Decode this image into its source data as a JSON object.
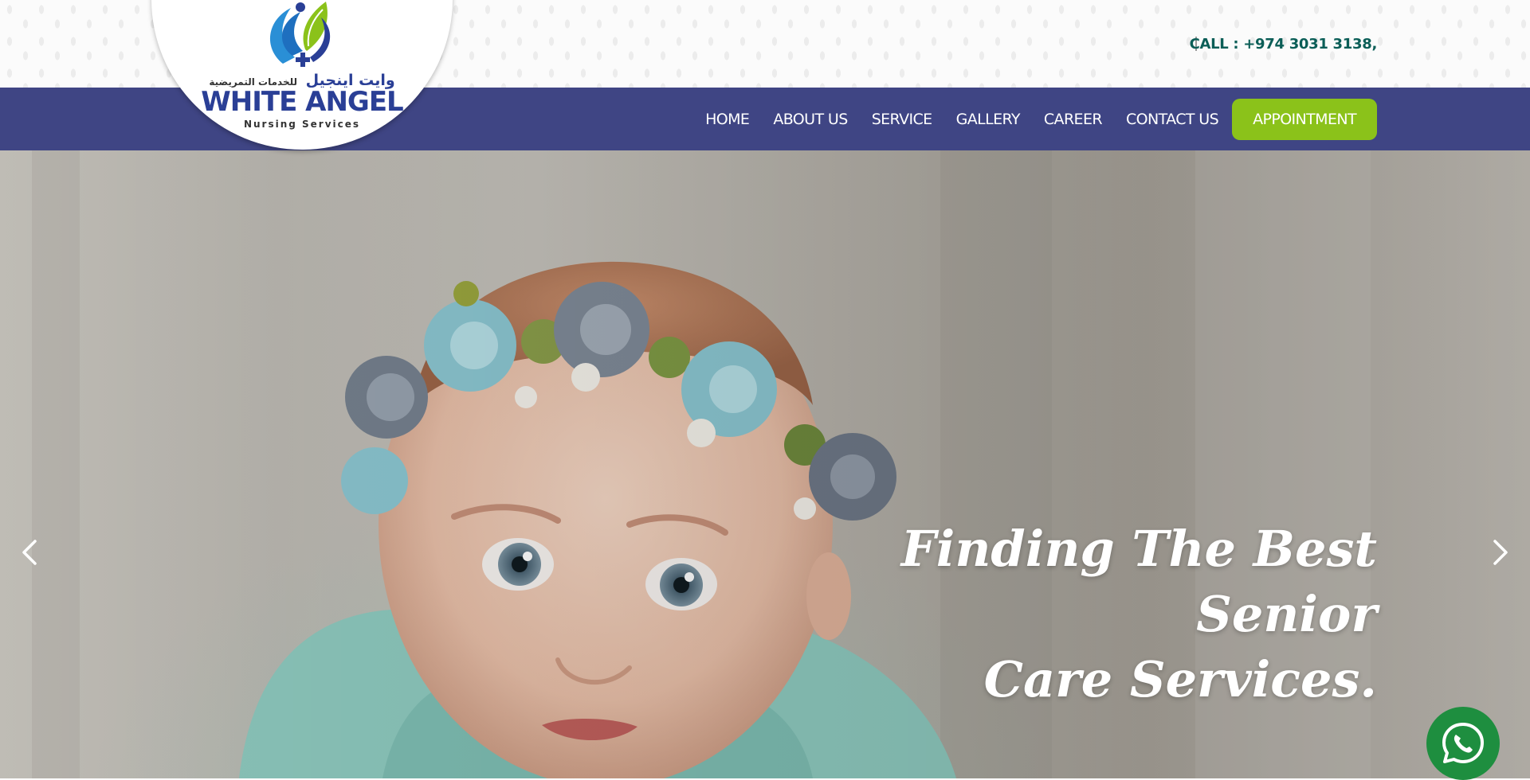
{
  "header": {
    "call_text": "CALL : +974 3031 3138,"
  },
  "logo": {
    "arabic_name": "وايت اينجيل",
    "arabic_tagline": "للخدمات التمريضية",
    "name": "WHITE ANGEL",
    "subtitle": "Nursing Services"
  },
  "nav": {
    "items": [
      {
        "label": "HOME"
      },
      {
        "label": "ABOUT US"
      },
      {
        "label": "SERVICE"
      },
      {
        "label": "GALLERY"
      },
      {
        "label": "CAREER"
      },
      {
        "label": "CONTACT US"
      }
    ],
    "cta_label": "APPOINTMENT"
  },
  "hero": {
    "title_line1": "Finding The Best Senior",
    "title_line2": "Care Services."
  },
  "colors": {
    "nav_bg": "#3f4584",
    "cta_bg": "#8bc21a",
    "phone_text": "#0b5e57",
    "whatsapp": "#1e8e3f"
  },
  "icons": {
    "prev": "chevron-left-icon",
    "next": "chevron-right-icon",
    "chat": "whatsapp-icon"
  }
}
